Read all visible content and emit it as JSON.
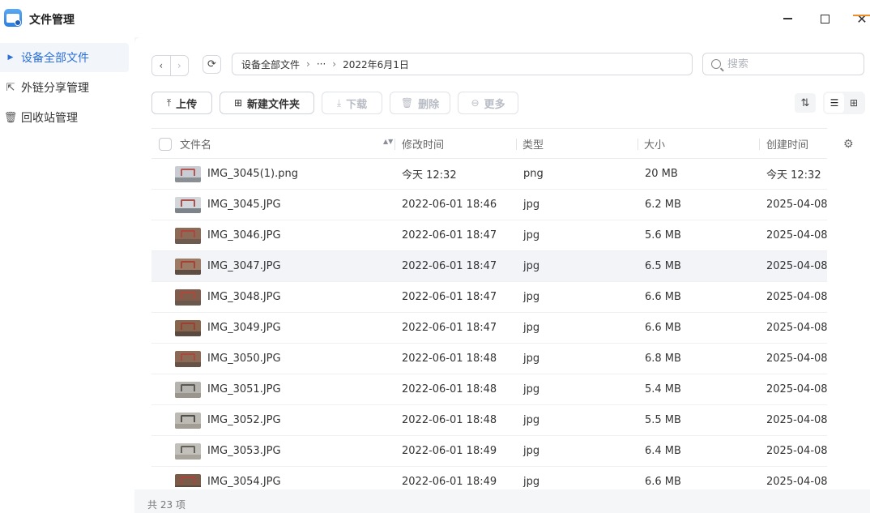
{
  "app": {
    "title": "文件管理",
    "icon": "file-manager-app-icon",
    "accent_color": "#2b6fd6"
  },
  "window": {
    "minimize_icon": "minimize-icon",
    "maximize_icon": "maximize-icon",
    "close_icon": "close-icon",
    "close_glyph": "✕"
  },
  "sidebar": {
    "items": [
      {
        "label": "设备全部文件",
        "icon": "triangle-right-icon",
        "glyph": "▶",
        "active": true
      },
      {
        "label": "外链分享管理",
        "icon": "share-link-icon",
        "glyph": "⇱",
        "active": false
      },
      {
        "label": "回收站管理",
        "icon": "trash-icon",
        "glyph": "🗑",
        "active": false
      }
    ]
  },
  "nav": {
    "back_glyph": "‹",
    "forward_glyph": "›",
    "refresh_glyph": "⟳"
  },
  "breadcrumb": {
    "items": [
      "设备全部文件",
      "···",
      "2022年6月1日"
    ],
    "separator": "›"
  },
  "search": {
    "placeholder": "搜索"
  },
  "toolbar": {
    "upload_label": "上传",
    "upload_glyph": "⤒",
    "new_folder_label": "新建文件夹",
    "new_folder_glyph": "⊞",
    "download_label": "下载",
    "download_glyph": "⤓",
    "delete_label": "删除",
    "delete_glyph": "🗑",
    "more_label": "更多",
    "more_glyph": "⊖",
    "sort_glyph": "⇅",
    "list_view_glyph": "☰",
    "grid_view_glyph": "⊞"
  },
  "table": {
    "headers": {
      "name": "文件名",
      "modified": "修改时间",
      "type": "类型",
      "size": "大小",
      "created": "创建时间"
    },
    "sort_glyph": "▲▼",
    "settings_glyph": "⚙",
    "rows": [
      {
        "name": "IMG_3045(1).png",
        "modified": "今天 12:32",
        "type": "png",
        "size": "20 MB",
        "created": "今天 12:32",
        "selected": false
      },
      {
        "name": "IMG_3045.JPG",
        "modified": "2022-06-01 18:46",
        "type": "jpg",
        "size": "6.2 MB",
        "created": "2025-04-08",
        "selected": false
      },
      {
        "name": "IMG_3046.JPG",
        "modified": "2022-06-01 18:47",
        "type": "jpg",
        "size": "5.6 MB",
        "created": "2025-04-08",
        "selected": false
      },
      {
        "name": "IMG_3047.JPG",
        "modified": "2022-06-01 18:47",
        "type": "jpg",
        "size": "6.5 MB",
        "created": "2025-04-08",
        "selected": true
      },
      {
        "name": "IMG_3048.JPG",
        "modified": "2022-06-01 18:47",
        "type": "jpg",
        "size": "6.6 MB",
        "created": "2025-04-08",
        "selected": false
      },
      {
        "name": "IMG_3049.JPG",
        "modified": "2022-06-01 18:47",
        "type": "jpg",
        "size": "6.6 MB",
        "created": "2025-04-08",
        "selected": false
      },
      {
        "name": "IMG_3050.JPG",
        "modified": "2022-06-01 18:48",
        "type": "jpg",
        "size": "6.8 MB",
        "created": "2025-04-08",
        "selected": false
      },
      {
        "name": "IMG_3051.JPG",
        "modified": "2022-06-01 18:48",
        "type": "jpg",
        "size": "5.4 MB",
        "created": "2025-04-08",
        "selected": false
      },
      {
        "name": "IMG_3052.JPG",
        "modified": "2022-06-01 18:48",
        "type": "jpg",
        "size": "5.5 MB",
        "created": "2025-04-08",
        "selected": false
      },
      {
        "name": "IMG_3053.JPG",
        "modified": "2022-06-01 18:49",
        "type": "jpg",
        "size": "6.4 MB",
        "created": "2025-04-08",
        "selected": false
      },
      {
        "name": "IMG_3054.JPG",
        "modified": "2022-06-01 18:49",
        "type": "jpg",
        "size": "6.6 MB",
        "created": "2025-04-08",
        "selected": false
      }
    ]
  },
  "footer": {
    "count_label": "共 23 项"
  }
}
